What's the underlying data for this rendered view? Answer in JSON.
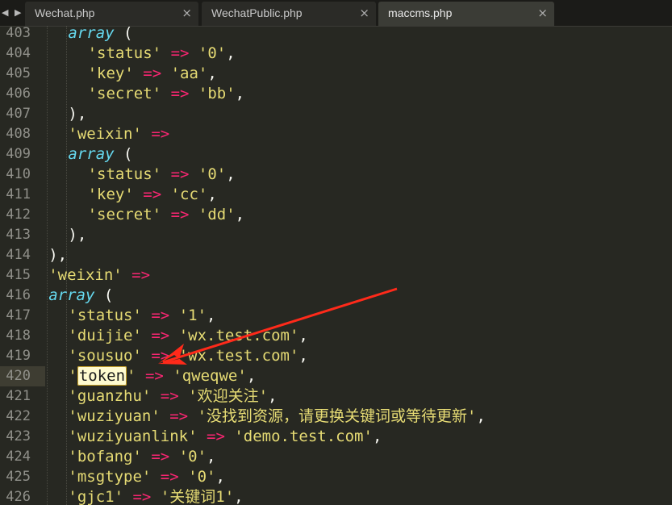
{
  "tabs": [
    {
      "label": "Wechat.php",
      "active": false
    },
    {
      "label": "WechatPublic.php",
      "active": false
    },
    {
      "label": "maccms.php",
      "active": true
    }
  ],
  "nav_arrows": "◀ ▶",
  "close_glyph": "×",
  "highlight_color": "#fffbd0",
  "current_line": "420",
  "lines": [
    {
      "n": "403",
      "indent": 2,
      "parts": [
        {
          "t": "kw",
          "v": "array"
        },
        {
          "t": "pl",
          "v": " ("
        }
      ]
    },
    {
      "n": "404",
      "indent": 3,
      "parts": [
        {
          "t": "str",
          "v": "'status'"
        },
        {
          "t": "pl",
          "v": " "
        },
        {
          "t": "op",
          "v": "=>"
        },
        {
          "t": "pl",
          "v": " "
        },
        {
          "t": "str",
          "v": "'0'"
        },
        {
          "t": "pl",
          "v": ","
        }
      ]
    },
    {
      "n": "405",
      "indent": 3,
      "parts": [
        {
          "t": "str",
          "v": "'key'"
        },
        {
          "t": "pl",
          "v": " "
        },
        {
          "t": "op",
          "v": "=>"
        },
        {
          "t": "pl",
          "v": " "
        },
        {
          "t": "str",
          "v": "'aa'"
        },
        {
          "t": "pl",
          "v": ","
        }
      ]
    },
    {
      "n": "406",
      "indent": 3,
      "parts": [
        {
          "t": "str",
          "v": "'secret'"
        },
        {
          "t": "pl",
          "v": " "
        },
        {
          "t": "op",
          "v": "=>"
        },
        {
          "t": "pl",
          "v": " "
        },
        {
          "t": "str",
          "v": "'bb'"
        },
        {
          "t": "pl",
          "v": ","
        }
      ]
    },
    {
      "n": "407",
      "indent": 2,
      "parts": [
        {
          "t": "pl",
          "v": "),"
        }
      ]
    },
    {
      "n": "408",
      "indent": 2,
      "parts": [
        {
          "t": "str",
          "v": "'weixin'"
        },
        {
          "t": "pl",
          "v": " "
        },
        {
          "t": "op",
          "v": "=>"
        }
      ]
    },
    {
      "n": "409",
      "indent": 2,
      "parts": [
        {
          "t": "kw",
          "v": "array"
        },
        {
          "t": "pl",
          "v": " ("
        }
      ]
    },
    {
      "n": "410",
      "indent": 3,
      "parts": [
        {
          "t": "str",
          "v": "'status'"
        },
        {
          "t": "pl",
          "v": " "
        },
        {
          "t": "op",
          "v": "=>"
        },
        {
          "t": "pl",
          "v": " "
        },
        {
          "t": "str",
          "v": "'0'"
        },
        {
          "t": "pl",
          "v": ","
        }
      ]
    },
    {
      "n": "411",
      "indent": 3,
      "parts": [
        {
          "t": "str",
          "v": "'key'"
        },
        {
          "t": "pl",
          "v": " "
        },
        {
          "t": "op",
          "v": "=>"
        },
        {
          "t": "pl",
          "v": " "
        },
        {
          "t": "str",
          "v": "'cc'"
        },
        {
          "t": "pl",
          "v": ","
        }
      ]
    },
    {
      "n": "412",
      "indent": 3,
      "parts": [
        {
          "t": "str",
          "v": "'secret'"
        },
        {
          "t": "pl",
          "v": " "
        },
        {
          "t": "op",
          "v": "=>"
        },
        {
          "t": "pl",
          "v": " "
        },
        {
          "t": "str",
          "v": "'dd'"
        },
        {
          "t": "pl",
          "v": ","
        }
      ]
    },
    {
      "n": "413",
      "indent": 2,
      "parts": [
        {
          "t": "pl",
          "v": "),"
        }
      ]
    },
    {
      "n": "414",
      "indent": 1,
      "parts": [
        {
          "t": "pl",
          "v": "),"
        }
      ]
    },
    {
      "n": "415",
      "indent": 1,
      "parts": [
        {
          "t": "str",
          "v": "'weixin'"
        },
        {
          "t": "pl",
          "v": " "
        },
        {
          "t": "op",
          "v": "=>"
        }
      ]
    },
    {
      "n": "416",
      "indent": 1,
      "parts": [
        {
          "t": "kw",
          "v": "array"
        },
        {
          "t": "pl",
          "v": " ("
        }
      ]
    },
    {
      "n": "417",
      "indent": 2,
      "parts": [
        {
          "t": "str",
          "v": "'status'"
        },
        {
          "t": "pl",
          "v": " "
        },
        {
          "t": "op",
          "v": "=>"
        },
        {
          "t": "pl",
          "v": " "
        },
        {
          "t": "str",
          "v": "'1'"
        },
        {
          "t": "pl",
          "v": ","
        }
      ]
    },
    {
      "n": "418",
      "indent": 2,
      "parts": [
        {
          "t": "str",
          "v": "'duijie'"
        },
        {
          "t": "pl",
          "v": " "
        },
        {
          "t": "op",
          "v": "=>"
        },
        {
          "t": "pl",
          "v": " "
        },
        {
          "t": "str",
          "v": "'wx.test.com'"
        },
        {
          "t": "pl",
          "v": ","
        }
      ]
    },
    {
      "n": "419",
      "indent": 2,
      "parts": [
        {
          "t": "str",
          "v": "'sousuo'"
        },
        {
          "t": "pl",
          "v": " "
        },
        {
          "t": "op",
          "v": "=>"
        },
        {
          "t": "pl",
          "v": " "
        },
        {
          "t": "str",
          "v": "'wx.test.com'"
        },
        {
          "t": "pl",
          "v": ","
        }
      ]
    },
    {
      "n": "420",
      "indent": 2,
      "parts": [
        {
          "t": "str",
          "v": "'"
        },
        {
          "t": "hl",
          "v": "token"
        },
        {
          "t": "str",
          "v": "'"
        },
        {
          "t": "pl",
          "v": " "
        },
        {
          "t": "op",
          "v": "=>"
        },
        {
          "t": "pl",
          "v": " "
        },
        {
          "t": "str",
          "v": "'qweqwe'"
        },
        {
          "t": "pl",
          "v": ","
        }
      ]
    },
    {
      "n": "421",
      "indent": 2,
      "parts": [
        {
          "t": "str",
          "v": "'guanzhu'"
        },
        {
          "t": "pl",
          "v": " "
        },
        {
          "t": "op",
          "v": "=>"
        },
        {
          "t": "pl",
          "v": " "
        },
        {
          "t": "str",
          "v": "'欢迎关注'"
        },
        {
          "t": "pl",
          "v": ","
        }
      ]
    },
    {
      "n": "422",
      "indent": 2,
      "parts": [
        {
          "t": "str",
          "v": "'wuziyuan'"
        },
        {
          "t": "pl",
          "v": " "
        },
        {
          "t": "op",
          "v": "=>"
        },
        {
          "t": "pl",
          "v": " "
        },
        {
          "t": "str",
          "v": "'没找到资源，请更换关键词或等待更新'"
        },
        {
          "t": "pl",
          "v": ","
        }
      ]
    },
    {
      "n": "423",
      "indent": 2,
      "parts": [
        {
          "t": "str",
          "v": "'wuziyuanlink'"
        },
        {
          "t": "pl",
          "v": " "
        },
        {
          "t": "op",
          "v": "=>"
        },
        {
          "t": "pl",
          "v": " "
        },
        {
          "t": "str",
          "v": "'demo.test.com'"
        },
        {
          "t": "pl",
          "v": ","
        }
      ]
    },
    {
      "n": "424",
      "indent": 2,
      "parts": [
        {
          "t": "str",
          "v": "'bofang'"
        },
        {
          "t": "pl",
          "v": " "
        },
        {
          "t": "op",
          "v": "=>"
        },
        {
          "t": "pl",
          "v": " "
        },
        {
          "t": "str",
          "v": "'0'"
        },
        {
          "t": "pl",
          "v": ","
        }
      ]
    },
    {
      "n": "425",
      "indent": 2,
      "parts": [
        {
          "t": "str",
          "v": "'msgtype'"
        },
        {
          "t": "pl",
          "v": " "
        },
        {
          "t": "op",
          "v": "=>"
        },
        {
          "t": "pl",
          "v": " "
        },
        {
          "t": "str",
          "v": "'0'"
        },
        {
          "t": "pl",
          "v": ","
        }
      ]
    },
    {
      "n": "426",
      "indent": 2,
      "parts": [
        {
          "t": "str",
          "v": "'gjc1'"
        },
        {
          "t": "pl",
          "v": " "
        },
        {
          "t": "op",
          "v": "=>"
        },
        {
          "t": "pl",
          "v": " "
        },
        {
          "t": "str",
          "v": "'关键词1'"
        },
        {
          "t": "pl",
          "v": ","
        }
      ]
    }
  ],
  "annotation": {
    "arrow_color": "#ff2a1a"
  }
}
